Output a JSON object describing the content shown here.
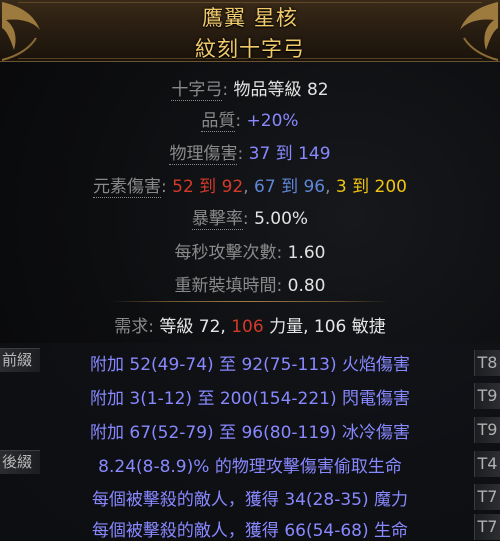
{
  "header": {
    "name": "鷹翼 星核",
    "base_type": "紋刻十字弓"
  },
  "properties": {
    "item_class_label": "十字弓",
    "item_level_text": "物品等級 82",
    "quality_label": "品質",
    "quality_value": "+20%",
    "physical_label": "物理傷害",
    "physical_value": "37 到 149",
    "elemental_label": "元素傷害",
    "fire_value": "52 到 92",
    "cold_value": "67 到 96",
    "lightning_value": "3 到 200",
    "crit_label": "暴擊率",
    "crit_value": "5.00%",
    "aps_label": "每秒攻擊次數",
    "aps_value": "1.60",
    "reload_label": "重新裝填時間",
    "reload_value": "0.80"
  },
  "requirements": {
    "label": "需求",
    "level": "等級 72",
    "str_value": "106",
    "str_label": "力量",
    "dex_text": "106 敏捷"
  },
  "prefix_label": "前綴",
  "suffix_label": "後綴",
  "modifiers": [
    {
      "text": "附加 52(49-74) 至 92(75-113) 火焰傷害",
      "tier": "T8"
    },
    {
      "text": "附加 3(1-12) 至 200(154-221) 閃電傷害",
      "tier": "T9"
    },
    {
      "text": "附加 67(52-79) 至 96(80-119) 冰冷傷害",
      "tier": "T9"
    },
    {
      "text": "8.24(8-8.9)% 的物理攻擊傷害偷取生命",
      "tier": "T4"
    },
    {
      "text": "每個被擊殺的敵人，獲得 34(28-35) 魔力",
      "tier": "T7"
    },
    {
      "text": "每個被擊殺的敵人，獲得 66(54-68) 生命",
      "tier": "T7"
    }
  ],
  "colors": {
    "title": "#f0c96a",
    "magic_mod": "#8888ff",
    "fire": "#d23a2a",
    "cold": "#5f86d6",
    "lightning": "#f1c40f"
  }
}
